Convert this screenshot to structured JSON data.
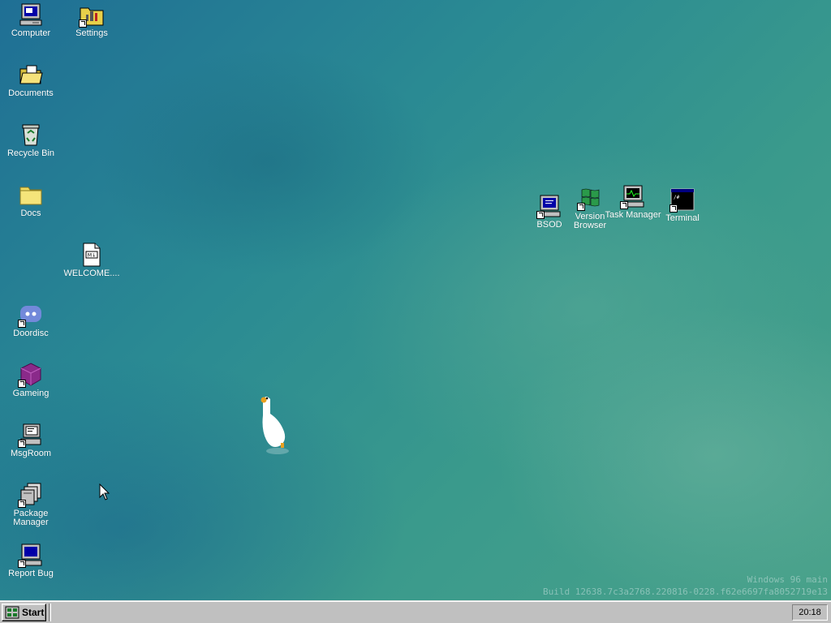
{
  "desktop": {
    "icons": {
      "computer": "Computer",
      "settings": "Settings",
      "documents": "Documents",
      "recycle_bin": "Recycle Bin",
      "docs": "Docs",
      "welcome": "WELCOME....",
      "doordisc": "Doordisc",
      "gameing": "Gameing",
      "msgroom": "MsgRoom",
      "package_manager": "Package Manager",
      "report_bug": "Report Bug",
      "bsod": "BSOD",
      "version_browser": "Version Browser",
      "task_manager": "Task Manager",
      "terminal": "Terminal"
    },
    "watermark": {
      "line1": "Windows 96 main",
      "line2": "Build 12638.7c3a2768.220816-0228.f62e6697fa8052719e13"
    }
  },
  "taskbar": {
    "start_label": "Start",
    "clock": "20:18"
  },
  "colors": {
    "taskbar_bg": "#c0c0c0",
    "desktop_teal": "#2a8a93"
  }
}
